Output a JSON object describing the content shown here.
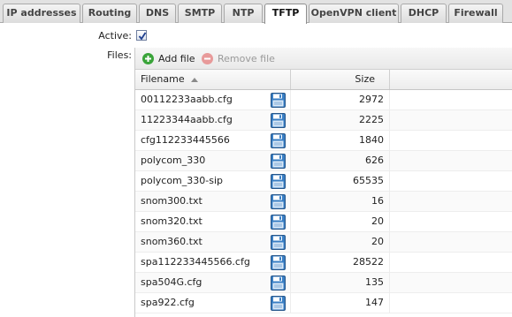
{
  "tabs": [
    {
      "label": "IP addresses",
      "active": false
    },
    {
      "label": "Routing",
      "active": false
    },
    {
      "label": "DNS",
      "active": false
    },
    {
      "label": "SMTP",
      "active": false
    },
    {
      "label": "NTP",
      "active": false
    },
    {
      "label": "TFTP",
      "active": true
    },
    {
      "label": "OpenVPN client",
      "active": false
    },
    {
      "label": "DHCP",
      "active": false
    },
    {
      "label": "Firewall",
      "active": false
    }
  ],
  "form": {
    "active_label": "Active:",
    "active_checked": true,
    "files_label": "Files:"
  },
  "toolbar": {
    "add_label": "Add file",
    "add_icon": "plus-circle-icon",
    "remove_label": "Remove file",
    "remove_icon": "minus-circle-icon"
  },
  "table": {
    "columns": {
      "filename": "Filename",
      "size": "Size"
    },
    "sort_icon": "sort-ascending-icon",
    "save_icon": "floppy-disk-icon",
    "rows": [
      {
        "filename": "00112233aabb.cfg",
        "size": "2972"
      },
      {
        "filename": "11223344aabb.cfg",
        "size": "2225"
      },
      {
        "filename": "cfg112233445566",
        "size": "1840"
      },
      {
        "filename": "polycom_330",
        "size": "626"
      },
      {
        "filename": "polycom_330-sip",
        "size": "65535"
      },
      {
        "filename": "snom300.txt",
        "size": "16"
      },
      {
        "filename": "snom320.txt",
        "size": "20"
      },
      {
        "filename": "snom360.txt",
        "size": "20"
      },
      {
        "filename": "spa112233445566.cfg",
        "size": "28522"
      },
      {
        "filename": "spa504G.cfg",
        "size": "135"
      },
      {
        "filename": "spa922.cfg",
        "size": "147"
      }
    ]
  },
  "colors": {
    "add": "#3aa43a",
    "remove": "#e07a7a",
    "floppy": "#3a7fc4"
  }
}
